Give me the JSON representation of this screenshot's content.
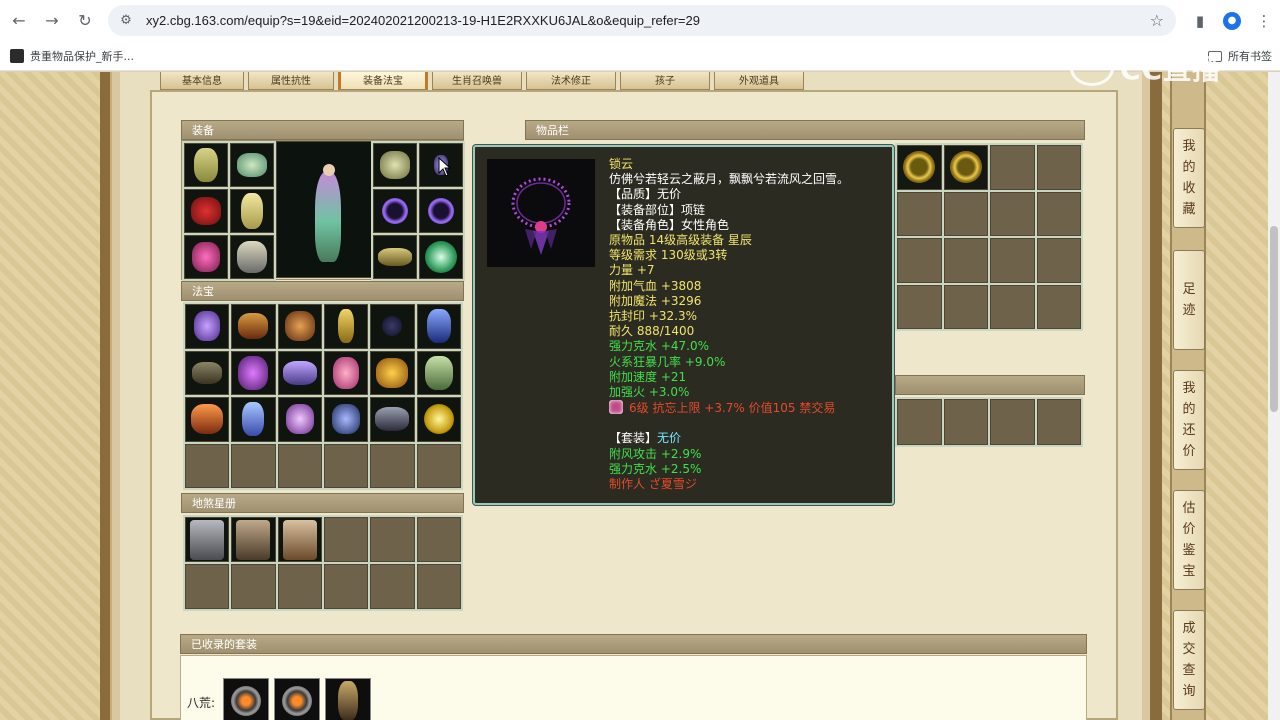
{
  "browser": {
    "url": "xy2.cbg.163.com/equip?s=19&eid=202402021200213-19-H1E2RXXKU6JAL&o&equip_refer=29",
    "bookmark": "贵重物品保护_新手...",
    "all_bookmarks": "所有书签",
    "back_icon": "←",
    "forward_icon": "→",
    "reload_icon": "↻",
    "site_icon": "⚙",
    "star_icon": "☆",
    "sidepanel_icon": "▮",
    "profile_icon": "●",
    "menu_icon": "⋮"
  },
  "watermark": "CC直播",
  "tabs": [
    {
      "label": "基本信息"
    },
    {
      "label": "属性抗性"
    },
    {
      "label": "装备法宝"
    },
    {
      "label": "生肖召唤兽"
    },
    {
      "label": "法术修正"
    },
    {
      "label": "孩子"
    },
    {
      "label": "外观道具"
    }
  ],
  "sections": {
    "equipment": "装备",
    "fabao": "法宝",
    "disha": "地煞星册",
    "inventory": "物品栏",
    "sets": "已收录的套装"
  },
  "set_row_label": "八荒:",
  "tooltip": {
    "name": "锁云",
    "desc": "仿佛兮若轻云之蔽月，飘飘兮若流风之回雪。",
    "quality": "【品质】无价",
    "slot": "【装备部位】项链",
    "role": "【装备角色】女性角色",
    "origin": "原物品 14级高级装备 星辰",
    "level_req": "等级需求 130级或3转",
    "strength": "力量 +7",
    "hp": "附加气血 +3808",
    "mp": "附加魔法 +3296",
    "seal_res": "抗封印 +32.3%",
    "durability": "耐久 888/1400",
    "water_break": "强力克水 +47.0%",
    "fire_crit": "火系狂暴几率 +9.0%",
    "speed": "附加速度 +21",
    "fire_boost": "加强火 +3.0%",
    "gem_line": "6级 抗忘上限 +3.7% 价值105 禁交易",
    "set_label": "【套装】",
    "set_value": "无价",
    "set_wind": "附风攻击 +2.9%",
    "set_water": "强力克水 +2.5%",
    "maker": "制作人 ざ夏雪ジ"
  },
  "side_nav": [
    {
      "label": "我的收藏",
      "chars": [
        "我",
        "的",
        "收",
        "藏"
      ]
    },
    {
      "label": "足迹",
      "chars": [
        "足",
        "迹"
      ]
    },
    {
      "label": "我的还价",
      "chars": [
        "我",
        "的",
        "还",
        "价"
      ]
    },
    {
      "label": "估价鉴宝",
      "chars": [
        "估",
        "价",
        "鉴",
        "宝"
      ]
    },
    {
      "label": "成交查询",
      "chars": [
        "成",
        "交",
        "查",
        "询"
      ]
    }
  ],
  "colors": {
    "tooltip_bg": "#2c2b22",
    "tooltip_border": "#9bc8b8",
    "yellow": "#f1e46a",
    "green": "#3fe04a",
    "red": "#e34a2a",
    "cyan": "#6ee7ff"
  }
}
